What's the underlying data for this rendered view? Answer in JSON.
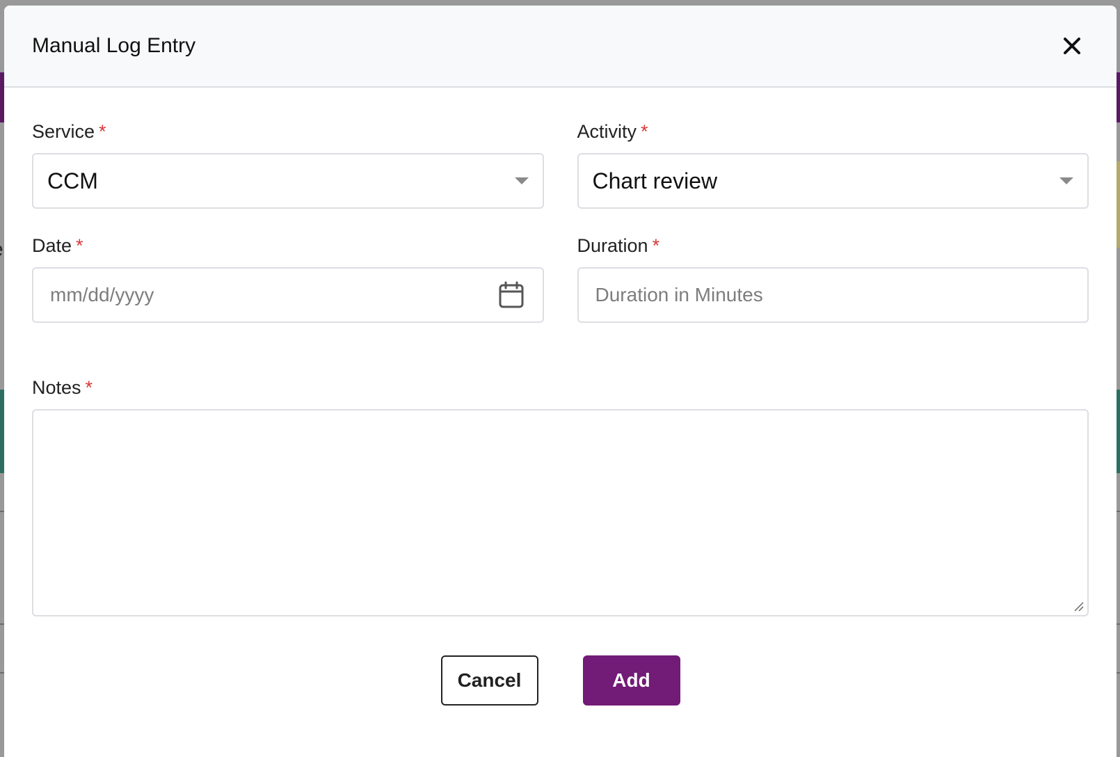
{
  "modal": {
    "title": "Manual Log Entry",
    "close_icon": "close-icon"
  },
  "form": {
    "service": {
      "label": "Service",
      "required_mark": "*",
      "value": "CCM"
    },
    "activity": {
      "label": "Activity",
      "required_mark": "*",
      "value": "Chart review"
    },
    "date": {
      "label": "Date",
      "required_mark": "*",
      "placeholder": "mm/dd/yyyy",
      "icon": "calendar-icon"
    },
    "duration": {
      "label": "Duration",
      "required_mark": "*",
      "placeholder": "Duration in Minutes"
    },
    "notes": {
      "label": "Notes",
      "required_mark": "*",
      "value": ""
    }
  },
  "buttons": {
    "cancel_label": "Cancel",
    "add_label": "Add"
  },
  "colors": {
    "primary": "#721b77",
    "required": "#d9383a",
    "border": "#dcdee2"
  }
}
